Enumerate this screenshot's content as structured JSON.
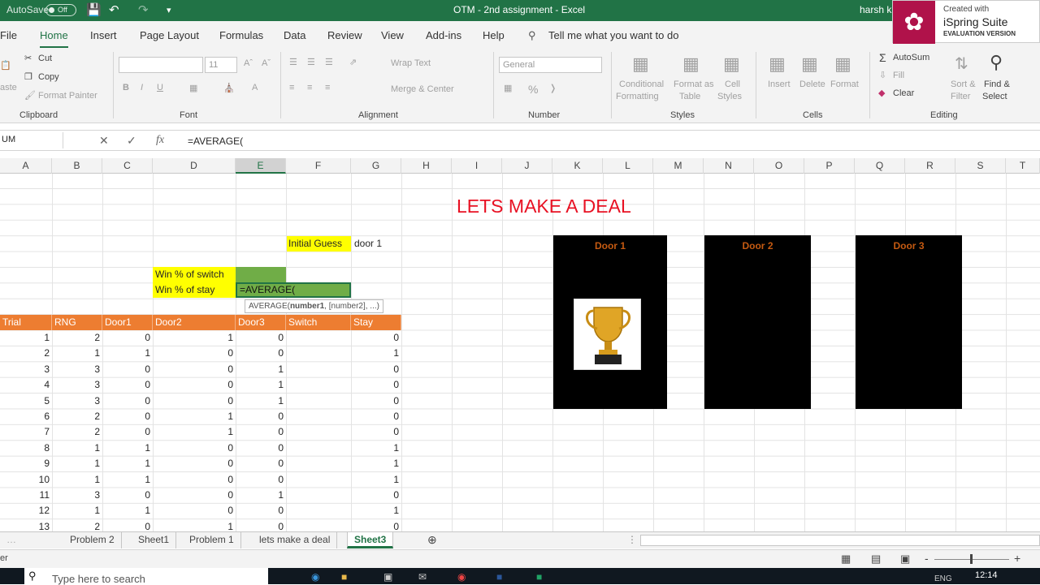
{
  "titlebar": {
    "autosave": "AutoSave",
    "toggle": "Off",
    "title": "OTM - 2nd assignment  -  Excel",
    "user": "harsh k"
  },
  "watermark": {
    "line1": "Created with",
    "line2": "iSpring Suite",
    "line3": "EVALUATION VERSION"
  },
  "tabs": [
    "File",
    "Home",
    "Insert",
    "Page Layout",
    "Formulas",
    "Data",
    "Review",
    "View",
    "Add-ins",
    "Help"
  ],
  "tellme": "Tell me what you want to do",
  "ribbon": {
    "cut": "Cut",
    "copy": "Copy",
    "format_painter": "Format Painter",
    "paste": "aste",
    "font_size": "11",
    "wrap_text": "Wrap Text",
    "merge_center": "Merge & Center",
    "number_format": "General",
    "conditional": "Conditional",
    "formatting": "Formatting",
    "format_as": "Format as",
    "table": "Table",
    "cell": "Cell",
    "styles_l": "Styles",
    "insert": "Insert",
    "delete": "Delete",
    "format": "Format",
    "autosum": "AutoSum",
    "fill": "Fill",
    "clear": "Clear",
    "sort": "Sort &",
    "filter": "Filter",
    "find": "Find &",
    "select": "Select",
    "groups": {
      "clipboard": "Clipboard",
      "font": "Font",
      "alignment": "Alignment",
      "number": "Number",
      "styles": "Styles",
      "cells": "Cells",
      "editing": "Editing"
    }
  },
  "formula_bar": {
    "name_box": "UM",
    "fx": "fx",
    "formula": "=AVERAGE("
  },
  "columns": [
    "A",
    "B",
    "C",
    "D",
    "E",
    "F",
    "G",
    "H",
    "I",
    "J",
    "K",
    "L",
    "M",
    "N",
    "O",
    "P",
    "Q",
    "R",
    "S",
    "T"
  ],
  "sheet": {
    "heading": "LETS MAKE A DEAL",
    "initial_guess_label": "Initial Guess",
    "initial_guess_value": "door 1",
    "win_switch": "Win % of switch",
    "win_stay": "Win % of stay",
    "editing_cell": "=AVERAGE(",
    "tooltip_fn": "AVERAGE(",
    "tooltip_arg1": "number1",
    "tooltip_rest": ", [number2], ...)",
    "headers": [
      "Trial",
      "RNG",
      "Door1",
      "Door2",
      "Door3",
      "Switch",
      "Stay"
    ],
    "rows": [
      [
        1,
        2,
        0,
        1,
        0,
        0
      ],
      [
        2,
        1,
        1,
        0,
        0,
        1
      ],
      [
        3,
        3,
        0,
        0,
        1,
        0
      ],
      [
        4,
        3,
        0,
        0,
        1,
        0
      ],
      [
        5,
        3,
        0,
        0,
        1,
        0
      ],
      [
        6,
        2,
        0,
        1,
        0,
        0
      ],
      [
        7,
        2,
        0,
        1,
        0,
        0
      ],
      [
        8,
        1,
        1,
        0,
        0,
        1
      ],
      [
        9,
        1,
        1,
        0,
        0,
        1
      ],
      [
        10,
        1,
        1,
        0,
        0,
        1
      ],
      [
        11,
        3,
        0,
        0,
        1,
        0
      ],
      [
        12,
        1,
        1,
        0,
        0,
        1
      ],
      [
        13,
        2,
        0,
        1,
        0,
        0
      ]
    ],
    "doors": [
      "Door 1",
      "Door 2",
      "Door 3"
    ]
  },
  "sheet_tabs": [
    "Problem 2",
    "Sheet1",
    "Problem 1",
    "lets make a deal",
    "Sheet3"
  ],
  "status": {
    "left": "er",
    "zoom_minus": "-",
    "zoom_plus": "+"
  },
  "taskbar": {
    "search": "Type here to search",
    "lang": "ENG",
    "time": "12:14"
  },
  "colors": {
    "excel_green": "#217346",
    "header_orange": "#ed7d31",
    "label_yellow": "#ffff00",
    "cell_green": "#70ad47",
    "title_red": "#e81123"
  }
}
